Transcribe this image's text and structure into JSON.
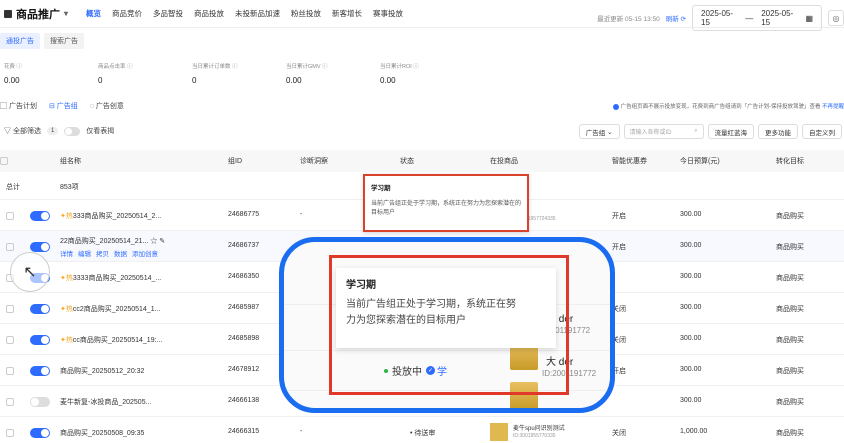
{
  "topbar": {
    "brand": "商品推广",
    "tabs": [
      "概览",
      "商品竞价",
      "多品智投",
      "商品投放",
      "未投新品加速",
      "粉丝投放",
      "新客增长",
      "赛事投放"
    ],
    "active_tab": "概览",
    "update_text": "最近更新 05-15 13:50",
    "refresh_label": "刷新",
    "date_start": "2025-05-15",
    "date_sep": "—",
    "date_end": "2025-05-15"
  },
  "subtabs": [
    "通投广告",
    "搜索广告"
  ],
  "metrics": [
    {
      "label": "花费",
      "value": "0.00"
    },
    {
      "label": "商品点击率",
      "value": "0"
    },
    {
      "label": "当日累计订单数",
      "value": "0"
    },
    {
      "label": "当日累计GMV",
      "value": "0.00"
    },
    {
      "label": "当日累计ROI",
      "value": "0.00"
    }
  ],
  "viewtabs": [
    "广告计划",
    "广告组",
    "广告创意"
  ],
  "active_view": "广告组",
  "notice": {
    "text": "广告组页面不展示投放变现，花费到商广告组请到「广告计划-保持投放驾驶」查看",
    "link": "不再提醒"
  },
  "filters": {
    "all_filter": "全部筛选",
    "count": "1",
    "only_label": "仅看表揭",
    "group_select": "广告组",
    "search_placeholder": "请输入各称或ID",
    "btn_flow": "流量红蓝海",
    "btn_more": "更多功能",
    "btn_custom": "自定义列"
  },
  "table": {
    "headers": [
      "组名称",
      "组ID",
      "诊断洞察",
      "状态",
      "在投商品",
      "智能优惠券",
      "今日预算(元)",
      "转化目标"
    ],
    "summary": {
      "label": "总计",
      "count": "853项"
    },
    "rows": [
      {
        "name": "333商品购买_20250514_2...",
        "id": "24686775",
        "diag": "-",
        "coupon": "开启",
        "budget": "300.00",
        "target": "商品购买",
        "hot": true,
        "on": true,
        "prod": "der",
        "pid": "ID:3001957724335"
      },
      {
        "name": "22商品购买_20250514_21...",
        "id": "24686737",
        "diag": "-",
        "coupon": "开启",
        "budget": "300.00",
        "target": "商品购买",
        "hot": false,
        "on": true,
        "ops": [
          "详情",
          "编辑",
          "拷贝",
          "数据",
          "添加创意"
        ]
      },
      {
        "name": "3333商品购买_20250514_...",
        "id": "24686350",
        "diag": "-",
        "coupon": "",
        "budget": "300.00",
        "target": "商品购买",
        "hot": true,
        "on": true
      },
      {
        "name": "cc2商品购买_20250514_1...",
        "id": "24685987",
        "diag": "-",
        "coupon": "关闭",
        "budget": "300.00",
        "target": "商品购买",
        "hot": true,
        "on": true
      },
      {
        "name": "cc商品购买_20250514_19:...",
        "id": "24685898",
        "diag": "-",
        "coupon": "关闭",
        "budget": "300.00",
        "target": "商品购买",
        "hot": true,
        "on": true
      },
      {
        "name": "商品购买_20250512_20:32",
        "id": "24678912",
        "diag": "-",
        "coupon": "开启",
        "budget": "300.00",
        "target": "商品购买",
        "hot": false,
        "on": true
      },
      {
        "name": "麦牛新复-冰投商品_202505...",
        "id": "24666138",
        "diag": "-",
        "coupon": "",
        "budget": "300.00",
        "target": "商品购买",
        "hot": false,
        "on": false
      },
      {
        "name": "商品购买_20250508_09:35",
        "id": "24666315",
        "diag": "-",
        "status": "待送审",
        "prod": "麦牛spu问识别测试",
        "pid": "ID:3001955770335",
        "coupon": "关闭",
        "budget": "1,000.00",
        "target": "商品购买",
        "hot": false,
        "on": true
      }
    ]
  },
  "tooltip_small": {
    "title": "学习期",
    "desc": "当前广告组正处于学习期，系统正在努力为您探索潜在的目标用户"
  },
  "lens": {
    "title": "学习期",
    "desc1": "当前广告组正处于学习期，系统正在努",
    "desc2": "力为您探索潜在的目标用户",
    "status": "投放中",
    "learn": "学",
    "prod1": "大 der",
    "pid1": "ID:2001191772",
    "prod2": "大 der",
    "pid2": "ID:2001191772"
  }
}
